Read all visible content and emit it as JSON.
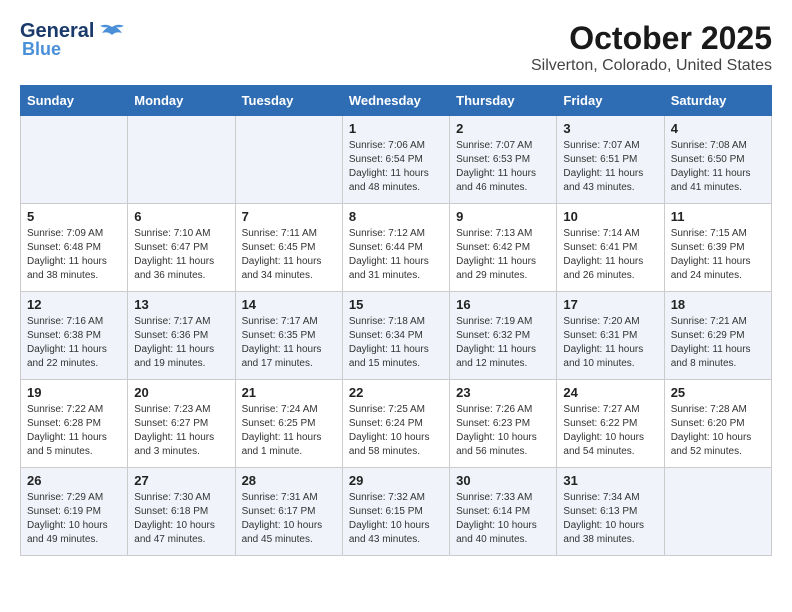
{
  "header": {
    "logo_general": "General",
    "logo_blue": "Blue",
    "title": "October 2025",
    "subtitle": "Silverton, Colorado, United States"
  },
  "days_of_week": [
    "Sunday",
    "Monday",
    "Tuesday",
    "Wednesday",
    "Thursday",
    "Friday",
    "Saturday"
  ],
  "weeks": [
    [
      {
        "day": "",
        "info": ""
      },
      {
        "day": "",
        "info": ""
      },
      {
        "day": "",
        "info": ""
      },
      {
        "day": "1",
        "info": "Sunrise: 7:06 AM\nSunset: 6:54 PM\nDaylight: 11 hours and 48 minutes."
      },
      {
        "day": "2",
        "info": "Sunrise: 7:07 AM\nSunset: 6:53 PM\nDaylight: 11 hours and 46 minutes."
      },
      {
        "day": "3",
        "info": "Sunrise: 7:07 AM\nSunset: 6:51 PM\nDaylight: 11 hours and 43 minutes."
      },
      {
        "day": "4",
        "info": "Sunrise: 7:08 AM\nSunset: 6:50 PM\nDaylight: 11 hours and 41 minutes."
      }
    ],
    [
      {
        "day": "5",
        "info": "Sunrise: 7:09 AM\nSunset: 6:48 PM\nDaylight: 11 hours and 38 minutes."
      },
      {
        "day": "6",
        "info": "Sunrise: 7:10 AM\nSunset: 6:47 PM\nDaylight: 11 hours and 36 minutes."
      },
      {
        "day": "7",
        "info": "Sunrise: 7:11 AM\nSunset: 6:45 PM\nDaylight: 11 hours and 34 minutes."
      },
      {
        "day": "8",
        "info": "Sunrise: 7:12 AM\nSunset: 6:44 PM\nDaylight: 11 hours and 31 minutes."
      },
      {
        "day": "9",
        "info": "Sunrise: 7:13 AM\nSunset: 6:42 PM\nDaylight: 11 hours and 29 minutes."
      },
      {
        "day": "10",
        "info": "Sunrise: 7:14 AM\nSunset: 6:41 PM\nDaylight: 11 hours and 26 minutes."
      },
      {
        "day": "11",
        "info": "Sunrise: 7:15 AM\nSunset: 6:39 PM\nDaylight: 11 hours and 24 minutes."
      }
    ],
    [
      {
        "day": "12",
        "info": "Sunrise: 7:16 AM\nSunset: 6:38 PM\nDaylight: 11 hours and 22 minutes."
      },
      {
        "day": "13",
        "info": "Sunrise: 7:17 AM\nSunset: 6:36 PM\nDaylight: 11 hours and 19 minutes."
      },
      {
        "day": "14",
        "info": "Sunrise: 7:17 AM\nSunset: 6:35 PM\nDaylight: 11 hours and 17 minutes."
      },
      {
        "day": "15",
        "info": "Sunrise: 7:18 AM\nSunset: 6:34 PM\nDaylight: 11 hours and 15 minutes."
      },
      {
        "day": "16",
        "info": "Sunrise: 7:19 AM\nSunset: 6:32 PM\nDaylight: 11 hours and 12 minutes."
      },
      {
        "day": "17",
        "info": "Sunrise: 7:20 AM\nSunset: 6:31 PM\nDaylight: 11 hours and 10 minutes."
      },
      {
        "day": "18",
        "info": "Sunrise: 7:21 AM\nSunset: 6:29 PM\nDaylight: 11 hours and 8 minutes."
      }
    ],
    [
      {
        "day": "19",
        "info": "Sunrise: 7:22 AM\nSunset: 6:28 PM\nDaylight: 11 hours and 5 minutes."
      },
      {
        "day": "20",
        "info": "Sunrise: 7:23 AM\nSunset: 6:27 PM\nDaylight: 11 hours and 3 minutes."
      },
      {
        "day": "21",
        "info": "Sunrise: 7:24 AM\nSunset: 6:25 PM\nDaylight: 11 hours and 1 minute."
      },
      {
        "day": "22",
        "info": "Sunrise: 7:25 AM\nSunset: 6:24 PM\nDaylight: 10 hours and 58 minutes."
      },
      {
        "day": "23",
        "info": "Sunrise: 7:26 AM\nSunset: 6:23 PM\nDaylight: 10 hours and 56 minutes."
      },
      {
        "day": "24",
        "info": "Sunrise: 7:27 AM\nSunset: 6:22 PM\nDaylight: 10 hours and 54 minutes."
      },
      {
        "day": "25",
        "info": "Sunrise: 7:28 AM\nSunset: 6:20 PM\nDaylight: 10 hours and 52 minutes."
      }
    ],
    [
      {
        "day": "26",
        "info": "Sunrise: 7:29 AM\nSunset: 6:19 PM\nDaylight: 10 hours and 49 minutes."
      },
      {
        "day": "27",
        "info": "Sunrise: 7:30 AM\nSunset: 6:18 PM\nDaylight: 10 hours and 47 minutes."
      },
      {
        "day": "28",
        "info": "Sunrise: 7:31 AM\nSunset: 6:17 PM\nDaylight: 10 hours and 45 minutes."
      },
      {
        "day": "29",
        "info": "Sunrise: 7:32 AM\nSunset: 6:15 PM\nDaylight: 10 hours and 43 minutes."
      },
      {
        "day": "30",
        "info": "Sunrise: 7:33 AM\nSunset: 6:14 PM\nDaylight: 10 hours and 40 minutes."
      },
      {
        "day": "31",
        "info": "Sunrise: 7:34 AM\nSunset: 6:13 PM\nDaylight: 10 hours and 38 minutes."
      },
      {
        "day": "",
        "info": ""
      }
    ]
  ]
}
